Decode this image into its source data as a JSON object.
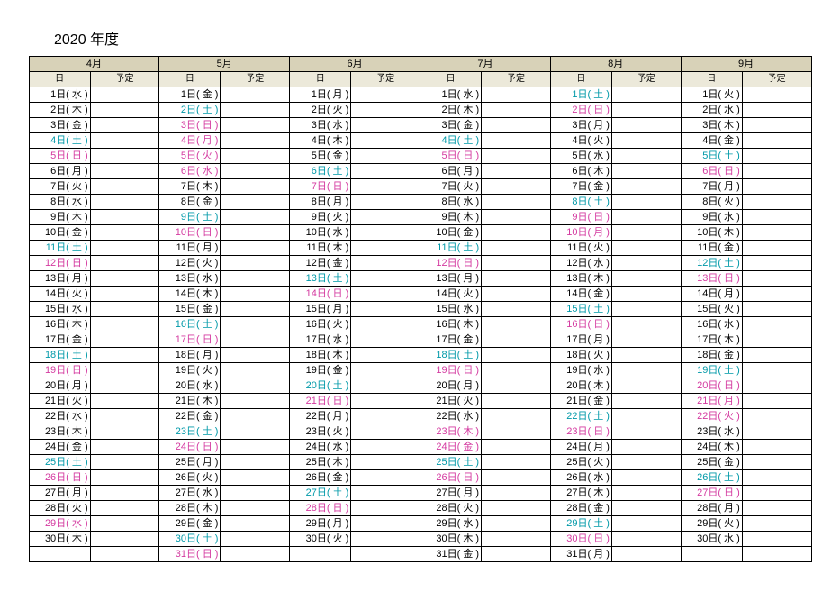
{
  "title": "2020 年度",
  "subheaders": {
    "day": "日",
    "plan": "予定"
  },
  "months": [
    "4月",
    "5月",
    "6月",
    "7月",
    "8月",
    "9月"
  ],
  "rows": 31,
  "days": {
    "4": [
      {
        "t": "1日( 水 )",
        "c": ""
      },
      {
        "t": "2日( 木 )",
        "c": ""
      },
      {
        "t": "3日( 金 )",
        "c": ""
      },
      {
        "t": "4日( 土 )",
        "c": "sat"
      },
      {
        "t": "5日( 日 )",
        "c": "sun"
      },
      {
        "t": "6日( 月 )",
        "c": ""
      },
      {
        "t": "7日( 火 )",
        "c": ""
      },
      {
        "t": "8日( 水 )",
        "c": ""
      },
      {
        "t": "9日( 木 )",
        "c": ""
      },
      {
        "t": "10日( 金 )",
        "c": ""
      },
      {
        "t": "11日( 土 )",
        "c": "sat"
      },
      {
        "t": "12日( 日 )",
        "c": "sun"
      },
      {
        "t": "13日( 月 )",
        "c": ""
      },
      {
        "t": "14日( 火 )",
        "c": ""
      },
      {
        "t": "15日( 水 )",
        "c": ""
      },
      {
        "t": "16日( 木 )",
        "c": ""
      },
      {
        "t": "17日( 金 )",
        "c": ""
      },
      {
        "t": "18日( 土 )",
        "c": "sat"
      },
      {
        "t": "19日( 日 )",
        "c": "sun"
      },
      {
        "t": "20日( 月 )",
        "c": ""
      },
      {
        "t": "21日( 火 )",
        "c": ""
      },
      {
        "t": "22日( 水 )",
        "c": ""
      },
      {
        "t": "23日( 木 )",
        "c": ""
      },
      {
        "t": "24日( 金 )",
        "c": ""
      },
      {
        "t": "25日( 土 )",
        "c": "sat"
      },
      {
        "t": "26日( 日 )",
        "c": "sun"
      },
      {
        "t": "27日( 月 )",
        "c": ""
      },
      {
        "t": "28日( 火 )",
        "c": ""
      },
      {
        "t": "29日( 水 )",
        "c": "hol"
      },
      {
        "t": "30日( 木 )",
        "c": ""
      },
      {
        "t": "",
        "c": ""
      }
    ],
    "5": [
      {
        "t": "1日( 金 )",
        "c": ""
      },
      {
        "t": "2日( 土 )",
        "c": "sat"
      },
      {
        "t": "3日( 日 )",
        "c": "sun"
      },
      {
        "t": "4日( 月 )",
        "c": "hol"
      },
      {
        "t": "5日( 火 )",
        "c": "hol"
      },
      {
        "t": "6日( 水 )",
        "c": "hol"
      },
      {
        "t": "7日( 木 )",
        "c": ""
      },
      {
        "t": "8日( 金 )",
        "c": ""
      },
      {
        "t": "9日( 土 )",
        "c": "sat"
      },
      {
        "t": "10日( 日 )",
        "c": "sun"
      },
      {
        "t": "11日( 月 )",
        "c": ""
      },
      {
        "t": "12日( 火 )",
        "c": ""
      },
      {
        "t": "13日( 水 )",
        "c": ""
      },
      {
        "t": "14日( 木 )",
        "c": ""
      },
      {
        "t": "15日( 金 )",
        "c": ""
      },
      {
        "t": "16日( 土 )",
        "c": "sat"
      },
      {
        "t": "17日( 日 )",
        "c": "sun"
      },
      {
        "t": "18日( 月 )",
        "c": ""
      },
      {
        "t": "19日( 火 )",
        "c": ""
      },
      {
        "t": "20日( 水 )",
        "c": ""
      },
      {
        "t": "21日( 木 )",
        "c": ""
      },
      {
        "t": "22日( 金 )",
        "c": ""
      },
      {
        "t": "23日( 土 )",
        "c": "sat"
      },
      {
        "t": "24日( 日 )",
        "c": "sun"
      },
      {
        "t": "25日( 月 )",
        "c": ""
      },
      {
        "t": "26日( 火 )",
        "c": ""
      },
      {
        "t": "27日( 水 )",
        "c": ""
      },
      {
        "t": "28日( 木 )",
        "c": ""
      },
      {
        "t": "29日( 金 )",
        "c": ""
      },
      {
        "t": "30日( 土 )",
        "c": "sat"
      },
      {
        "t": "31日( 日 )",
        "c": "sun"
      }
    ],
    "6": [
      {
        "t": "1日( 月 )",
        "c": ""
      },
      {
        "t": "2日( 火 )",
        "c": ""
      },
      {
        "t": "3日( 水 )",
        "c": ""
      },
      {
        "t": "4日( 木 )",
        "c": ""
      },
      {
        "t": "5日( 金 )",
        "c": ""
      },
      {
        "t": "6日( 土 )",
        "c": "sat"
      },
      {
        "t": "7日( 日 )",
        "c": "sun"
      },
      {
        "t": "8日( 月 )",
        "c": ""
      },
      {
        "t": "9日( 火 )",
        "c": ""
      },
      {
        "t": "10日( 水 )",
        "c": ""
      },
      {
        "t": "11日( 木 )",
        "c": ""
      },
      {
        "t": "12日( 金 )",
        "c": ""
      },
      {
        "t": "13日( 土 )",
        "c": "sat"
      },
      {
        "t": "14日( 日 )",
        "c": "sun"
      },
      {
        "t": "15日( 月 )",
        "c": ""
      },
      {
        "t": "16日( 火 )",
        "c": ""
      },
      {
        "t": "17日( 水 )",
        "c": ""
      },
      {
        "t": "18日( 木 )",
        "c": ""
      },
      {
        "t": "19日( 金 )",
        "c": ""
      },
      {
        "t": "20日( 土 )",
        "c": "sat"
      },
      {
        "t": "21日( 日 )",
        "c": "sun"
      },
      {
        "t": "22日( 月 )",
        "c": ""
      },
      {
        "t": "23日( 火 )",
        "c": ""
      },
      {
        "t": "24日( 水 )",
        "c": ""
      },
      {
        "t": "25日( 木 )",
        "c": ""
      },
      {
        "t": "26日( 金 )",
        "c": ""
      },
      {
        "t": "27日( 土 )",
        "c": "sat"
      },
      {
        "t": "28日( 日 )",
        "c": "sun"
      },
      {
        "t": "29日( 月 )",
        "c": ""
      },
      {
        "t": "30日( 火 )",
        "c": ""
      },
      {
        "t": "",
        "c": ""
      }
    ],
    "7": [
      {
        "t": "1日( 水 )",
        "c": ""
      },
      {
        "t": "2日( 木 )",
        "c": ""
      },
      {
        "t": "3日( 金 )",
        "c": ""
      },
      {
        "t": "4日( 土 )",
        "c": "sat"
      },
      {
        "t": "5日( 日 )",
        "c": "sun"
      },
      {
        "t": "6日( 月 )",
        "c": ""
      },
      {
        "t": "7日( 火 )",
        "c": ""
      },
      {
        "t": "8日( 水 )",
        "c": ""
      },
      {
        "t": "9日( 木 )",
        "c": ""
      },
      {
        "t": "10日( 金 )",
        "c": ""
      },
      {
        "t": "11日( 土 )",
        "c": "sat"
      },
      {
        "t": "12日( 日 )",
        "c": "sun"
      },
      {
        "t": "13日( 月 )",
        "c": ""
      },
      {
        "t": "14日( 火 )",
        "c": ""
      },
      {
        "t": "15日( 水 )",
        "c": ""
      },
      {
        "t": "16日( 木 )",
        "c": ""
      },
      {
        "t": "17日( 金 )",
        "c": ""
      },
      {
        "t": "18日( 土 )",
        "c": "sat"
      },
      {
        "t": "19日( 日 )",
        "c": "sun"
      },
      {
        "t": "20日( 月 )",
        "c": ""
      },
      {
        "t": "21日( 火 )",
        "c": ""
      },
      {
        "t": "22日( 水 )",
        "c": ""
      },
      {
        "t": "23日( 木 )",
        "c": "hol"
      },
      {
        "t": "24日( 金 )",
        "c": "hol"
      },
      {
        "t": "25日( 土 )",
        "c": "sat"
      },
      {
        "t": "26日( 日 )",
        "c": "sun"
      },
      {
        "t": "27日( 月 )",
        "c": ""
      },
      {
        "t": "28日( 火 )",
        "c": ""
      },
      {
        "t": "29日( 水 )",
        "c": ""
      },
      {
        "t": "30日( 木 )",
        "c": ""
      },
      {
        "t": "31日( 金 )",
        "c": ""
      }
    ],
    "8": [
      {
        "t": "1日( 土 )",
        "c": "sat"
      },
      {
        "t": "2日( 日 )",
        "c": "sun"
      },
      {
        "t": "3日( 月 )",
        "c": ""
      },
      {
        "t": "4日( 火 )",
        "c": ""
      },
      {
        "t": "5日( 水 )",
        "c": ""
      },
      {
        "t": "6日( 木 )",
        "c": ""
      },
      {
        "t": "7日( 金 )",
        "c": ""
      },
      {
        "t": "8日( 土 )",
        "c": "sat"
      },
      {
        "t": "9日( 日 )",
        "c": "sun"
      },
      {
        "t": "10日( 月 )",
        "c": "hol"
      },
      {
        "t": "11日( 火 )",
        "c": ""
      },
      {
        "t": "12日( 水 )",
        "c": ""
      },
      {
        "t": "13日( 木 )",
        "c": ""
      },
      {
        "t": "14日( 金 )",
        "c": ""
      },
      {
        "t": "15日( 土 )",
        "c": "sat"
      },
      {
        "t": "16日( 日 )",
        "c": "sun"
      },
      {
        "t": "17日( 月 )",
        "c": ""
      },
      {
        "t": "18日( 火 )",
        "c": ""
      },
      {
        "t": "19日( 水 )",
        "c": ""
      },
      {
        "t": "20日( 木 )",
        "c": ""
      },
      {
        "t": "21日( 金 )",
        "c": ""
      },
      {
        "t": "22日( 土 )",
        "c": "sat"
      },
      {
        "t": "23日( 日 )",
        "c": "sun"
      },
      {
        "t": "24日( 月 )",
        "c": ""
      },
      {
        "t": "25日( 火 )",
        "c": ""
      },
      {
        "t": "26日( 水 )",
        "c": ""
      },
      {
        "t": "27日( 木 )",
        "c": ""
      },
      {
        "t": "28日( 金 )",
        "c": ""
      },
      {
        "t": "29日( 土 )",
        "c": "sat"
      },
      {
        "t": "30日( 日 )",
        "c": "sun"
      },
      {
        "t": "31日( 月 )",
        "c": ""
      }
    ],
    "9": [
      {
        "t": "1日( 火 )",
        "c": ""
      },
      {
        "t": "2日( 水 )",
        "c": ""
      },
      {
        "t": "3日( 木 )",
        "c": ""
      },
      {
        "t": "4日( 金 )",
        "c": ""
      },
      {
        "t": "5日( 土 )",
        "c": "sat"
      },
      {
        "t": "6日( 日 )",
        "c": "sun"
      },
      {
        "t": "7日( 月 )",
        "c": ""
      },
      {
        "t": "8日( 火 )",
        "c": ""
      },
      {
        "t": "9日( 水 )",
        "c": ""
      },
      {
        "t": "10日( 木 )",
        "c": ""
      },
      {
        "t": "11日( 金 )",
        "c": ""
      },
      {
        "t": "12日( 土 )",
        "c": "sat"
      },
      {
        "t": "13日( 日 )",
        "c": "sun"
      },
      {
        "t": "14日( 月 )",
        "c": ""
      },
      {
        "t": "15日( 火 )",
        "c": ""
      },
      {
        "t": "16日( 水 )",
        "c": ""
      },
      {
        "t": "17日( 木 )",
        "c": ""
      },
      {
        "t": "18日( 金 )",
        "c": ""
      },
      {
        "t": "19日( 土 )",
        "c": "sat"
      },
      {
        "t": "20日( 日 )",
        "c": "sun"
      },
      {
        "t": "21日( 月 )",
        "c": "hol"
      },
      {
        "t": "22日( 火 )",
        "c": "hol"
      },
      {
        "t": "23日( 水 )",
        "c": ""
      },
      {
        "t": "24日( 木 )",
        "c": ""
      },
      {
        "t": "25日( 金 )",
        "c": ""
      },
      {
        "t": "26日( 土 )",
        "c": "sat"
      },
      {
        "t": "27日( 日 )",
        "c": "sun"
      },
      {
        "t": "28日( 月 )",
        "c": ""
      },
      {
        "t": "29日( 火 )",
        "c": ""
      },
      {
        "t": "30日( 水 )",
        "c": ""
      },
      {
        "t": "",
        "c": ""
      }
    ]
  }
}
